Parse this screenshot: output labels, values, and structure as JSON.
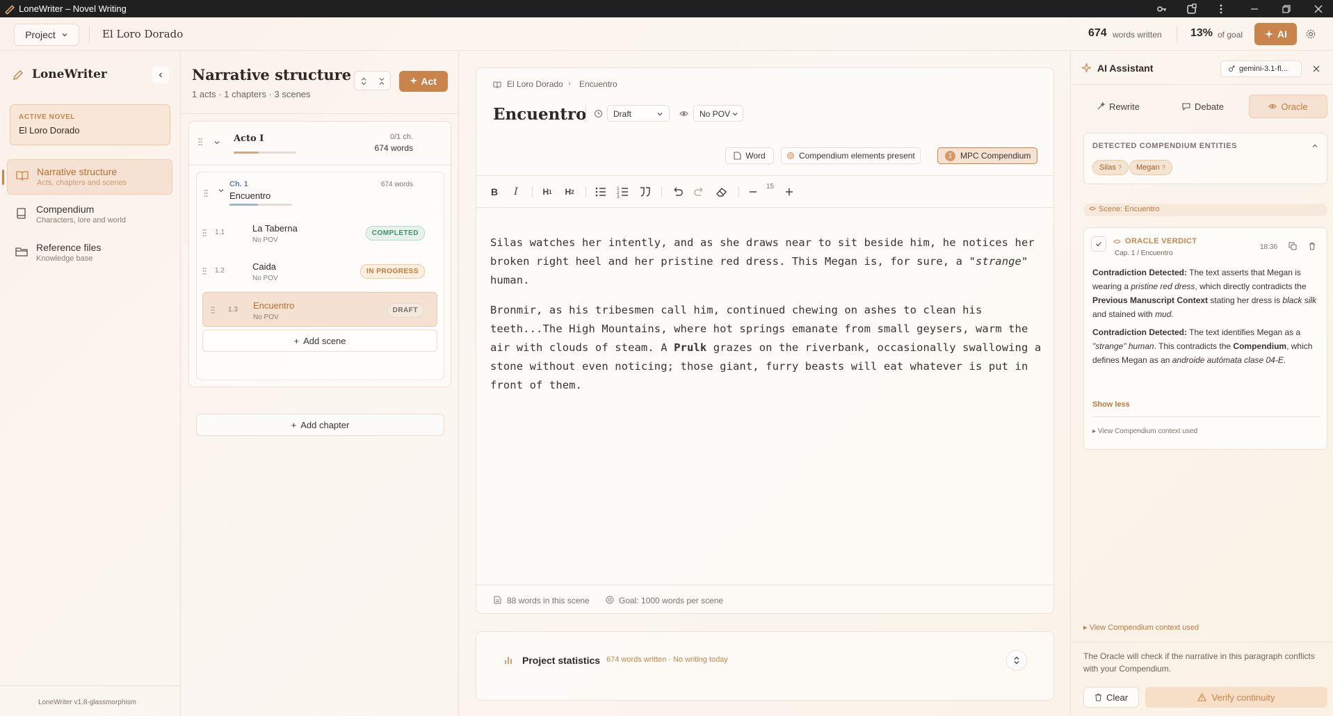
{
  "window": {
    "title": "LoneWriter – Novel Writing"
  },
  "header": {
    "project_menu": "Project",
    "novel_name": "El Loro Dorado",
    "words_written_value": "674",
    "words_written_label": "words written",
    "goal_value": "13%",
    "goal_label": "of goal",
    "ai_button": "AI"
  },
  "sidebar": {
    "app_name": "LoneWriter",
    "active_novel_label": "ACTIVE NOVEL",
    "active_novel_name": "El Loro Dorado",
    "items": [
      {
        "title": "Narrative structure",
        "subtitle": "Acts, chapters and scenes",
        "icon": "book-open-icon",
        "active": true
      },
      {
        "title": "Compendium",
        "subtitle": "Characters, lore and world",
        "icon": "book-icon",
        "active": false
      },
      {
        "title": "Reference files",
        "subtitle": "Knowledge base",
        "icon": "folder-icon",
        "active": false
      }
    ],
    "version": "LoneWriter v1.8-glassmorphism"
  },
  "structure": {
    "title": "Narrative structure",
    "summary": "1 acts · 1 chapters · 3 scenes",
    "add_act_button": "Act",
    "act": {
      "name": "Acto I",
      "chapters_count": "0/1 ch.",
      "words": "674 words",
      "progress": 0.4
    },
    "chapter": {
      "label": "Ch. 1",
      "name": "Encuentro",
      "words": "674 words",
      "progress": 0.45
    },
    "scenes": [
      {
        "num": "1.1",
        "name": "La Taberna",
        "pov": "No POV",
        "status": "COMPLETED"
      },
      {
        "num": "1.2",
        "name": "Caida",
        "pov": "No POV",
        "status": "IN PROGRESS"
      },
      {
        "num": "1.3",
        "name": "Encuentro",
        "pov": "No POV",
        "status": "DRAFT"
      }
    ],
    "add_scene": "Add scene",
    "add_chapter": "Add chapter"
  },
  "editor": {
    "breadcrumb": [
      "El Loro Dorado",
      "Encuentro"
    ],
    "scene_title": "Encuentro",
    "status_select": "Draft",
    "pov_select": "No POV",
    "word_button": "Word",
    "compendium_present": "Compendium elements present",
    "mpc_count": "1",
    "mpc_label": "MPC Compendium",
    "font_size": "15",
    "para1_a": "Silas watches her intently, and as she draws near to sit beside him, he notices her broken right heel and her pristine red dress. This Megan is, for sure, a ",
    "para1_em": "\"strange\"",
    "para1_b": " human.",
    "para2_a": "Bronmir, as his tribesmen call him, continued chewing on ashes to clean his teeth...The High Mountains, where hot springs emanate from small geysers, warm the air with clouds of steam. A ",
    "para2_strong": "Prulk",
    "para2_b": " grazes on the riverbank, occasionally swallowing a stone without even noticing; those giant, furry beasts will eat whatever is put in front of them.",
    "footer_words": "88 words in this scene",
    "footer_goal": "Goal: 1000 words per scene"
  },
  "stats": {
    "title": "Project statistics",
    "summary": "674 words written · No writing today"
  },
  "ai": {
    "title": "AI Assistant",
    "model": "gemini-3.1-fl...",
    "tabs": [
      "Rewrite",
      "Debate",
      "Oracle"
    ],
    "entities_title": "DETECTED COMPENDIUM ENTITIES",
    "entities": [
      "Silas",
      "Megan"
    ],
    "entity_suffix": "?",
    "scene_label": "Scene: Encuentro",
    "verdict_title": "ORACLE VERDICT",
    "verdict_sub": "Cap. 1 / Encuentro",
    "verdict_time": "18:36",
    "v1_b1": "Contradiction Detected:",
    "v1_t1": " The text asserts that Megan is wearing a ",
    "v1_i1": "pristine red dress",
    "v1_t2": ", which directly contradicts the ",
    "v1_b2": "Previous Manuscript Context",
    "v1_t3": " stating her dress is ",
    "v1_i2": "black silk",
    "v1_t4": " and stained with ",
    "v1_i3": "mud",
    "v1_t5": ".",
    "v2_b1": "Contradiction Detected:",
    "v2_t1": " The text identifies Megan as a ",
    "v2_i1": "\"strange\" human",
    "v2_t2": ". This contradicts the ",
    "v2_b2": "Compendium",
    "v2_t3": ", which defines Megan as an ",
    "v2_i2": "androide autómata clase 04-E",
    "v2_t4": ".",
    "show_less": "Show less",
    "context_inner": "View Compendium context used",
    "context_outer": "View Compendium context used",
    "note": "The Oracle will check if the narrative in this paragraph conflicts with your Compendium.",
    "clear_button": "Clear",
    "verify_button": "Verify continuity"
  },
  "colors": {
    "accent": "#c8844a",
    "accent_dark": "#b66e33",
    "completed": "#3f8f6a",
    "in_progress": "#c27a3a"
  }
}
